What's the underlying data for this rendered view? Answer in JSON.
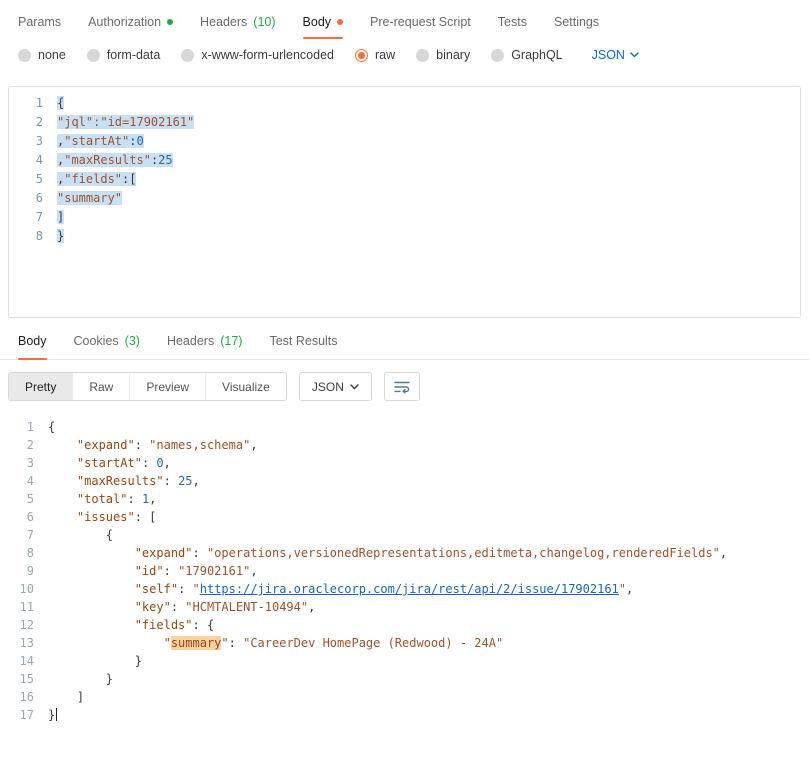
{
  "colors": {
    "accent_orange": "#ff6c37",
    "badge_green": "#28a745",
    "link_blue": "#1a66bc",
    "selection_blue": "#c7e0f5",
    "search_highlight_orange": "#fbd3a0"
  },
  "request": {
    "tabs": [
      {
        "label": "Params"
      },
      {
        "label": "Authorization",
        "dot": "green"
      },
      {
        "label": "Headers",
        "count": "(10)"
      },
      {
        "label": "Body",
        "dot": "orange",
        "active": true
      },
      {
        "label": "Pre-request Script"
      },
      {
        "label": "Tests"
      },
      {
        "label": "Settings"
      }
    ],
    "body_types": [
      "none",
      "form-data",
      "x-www-form-urlencoded",
      "raw",
      "binary",
      "GraphQL"
    ],
    "selected_body_type": "raw",
    "language": "JSON",
    "lines": [
      [
        {
          "t": "{",
          "c": "pun",
          "sel": true
        }
      ],
      [
        {
          "t": "\"jql\":\"id=17902161\"",
          "c": "str",
          "sel": true
        }
      ],
      [
        {
          "t": ",",
          "c": "pun",
          "sel": true
        },
        {
          "t": "\"startAt\"",
          "c": "str",
          "sel": true
        },
        {
          "t": ":",
          "c": "pun",
          "sel": true
        },
        {
          "t": "0",
          "c": "num",
          "sel": true
        }
      ],
      [
        {
          "t": ",",
          "c": "pun",
          "sel": true
        },
        {
          "t": "\"maxResults\"",
          "c": "str",
          "sel": true
        },
        {
          "t": ":",
          "c": "pun",
          "sel": true
        },
        {
          "t": "25",
          "c": "num",
          "sel": true
        }
      ],
      [
        {
          "t": ",",
          "c": "pun",
          "sel": true
        },
        {
          "t": "\"fields\"",
          "c": "str",
          "sel": true
        },
        {
          "t": ":[",
          "c": "pun",
          "sel": true
        }
      ],
      [
        {
          "t": "\"summary\"",
          "c": "str",
          "sel": true
        }
      ],
      [
        {
          "t": "]",
          "c": "pun",
          "sel": true
        }
      ],
      [
        {
          "t": "}",
          "c": "pun",
          "sel": true
        }
      ]
    ]
  },
  "response": {
    "tabs": [
      {
        "label": "Body",
        "active": true
      },
      {
        "label": "Cookies",
        "count": "(3)"
      },
      {
        "label": "Headers",
        "count": "(17)"
      },
      {
        "label": "Test Results"
      }
    ],
    "views": [
      "Pretty",
      "Raw",
      "Preview",
      "Visualize"
    ],
    "active_view": "Pretty",
    "language": "JSON",
    "lines": [
      [
        {
          "t": "{",
          "c": "pun"
        }
      ],
      [
        {
          "t": "    ",
          "c": "ws"
        },
        {
          "t": "\"expand\"",
          "c": "key"
        },
        {
          "t": ": ",
          "c": "pun"
        },
        {
          "t": "\"names,schema\"",
          "c": "str"
        },
        {
          "t": ",",
          "c": "pun"
        }
      ],
      [
        {
          "t": "    ",
          "c": "ws"
        },
        {
          "t": "\"startAt\"",
          "c": "key"
        },
        {
          "t": ": ",
          "c": "pun"
        },
        {
          "t": "0",
          "c": "num"
        },
        {
          "t": ",",
          "c": "pun"
        }
      ],
      [
        {
          "t": "    ",
          "c": "ws"
        },
        {
          "t": "\"maxResults\"",
          "c": "key"
        },
        {
          "t": ": ",
          "c": "pun"
        },
        {
          "t": "25",
          "c": "num"
        },
        {
          "t": ",",
          "c": "pun"
        }
      ],
      [
        {
          "t": "    ",
          "c": "ws"
        },
        {
          "t": "\"total\"",
          "c": "key"
        },
        {
          "t": ": ",
          "c": "pun"
        },
        {
          "t": "1",
          "c": "num"
        },
        {
          "t": ",",
          "c": "pun"
        }
      ],
      [
        {
          "t": "    ",
          "c": "ws"
        },
        {
          "t": "\"issues\"",
          "c": "key"
        },
        {
          "t": ": ",
          "c": "pun"
        },
        {
          "t": "[",
          "c": "pun"
        }
      ],
      [
        {
          "t": "        {",
          "c": "pun"
        }
      ],
      [
        {
          "t": "            ",
          "c": "ws"
        },
        {
          "t": "\"expand\"",
          "c": "key"
        },
        {
          "t": ": ",
          "c": "pun"
        },
        {
          "t": "\"operations,versionedRepresentations,editmeta,changelog,renderedFields\"",
          "c": "str"
        },
        {
          "t": ",",
          "c": "pun"
        }
      ],
      [
        {
          "t": "            ",
          "c": "ws"
        },
        {
          "t": "\"id\"",
          "c": "key"
        },
        {
          "t": ": ",
          "c": "pun"
        },
        {
          "t": "\"17902161\"",
          "c": "str"
        },
        {
          "t": ",",
          "c": "pun"
        }
      ],
      [
        {
          "t": "            ",
          "c": "ws"
        },
        {
          "t": "\"self\"",
          "c": "key"
        },
        {
          "t": ": ",
          "c": "pun"
        },
        {
          "t": "\"",
          "c": "str"
        },
        {
          "t": "https://jira.oraclecorp.com/jira/rest/api/2/issue/17902161",
          "c": "link"
        },
        {
          "t": "\"",
          "c": "str"
        },
        {
          "t": ",",
          "c": "pun"
        }
      ],
      [
        {
          "t": "            ",
          "c": "ws"
        },
        {
          "t": "\"key\"",
          "c": "key"
        },
        {
          "t": ": ",
          "c": "pun"
        },
        {
          "t": "\"HCMTALENT-10494\"",
          "c": "str"
        },
        {
          "t": ",",
          "c": "pun"
        }
      ],
      [
        {
          "t": "            ",
          "c": "ws"
        },
        {
          "t": "\"fields\"",
          "c": "key"
        },
        {
          "t": ": ",
          "c": "pun"
        },
        {
          "t": "{",
          "c": "pun"
        }
      ],
      [
        {
          "t": "                ",
          "c": "ws"
        },
        {
          "t": "\"",
          "c": "key"
        },
        {
          "t": "summary",
          "c": "key hl"
        },
        {
          "t": "\"",
          "c": "key"
        },
        {
          "t": ": ",
          "c": "pun"
        },
        {
          "t": "\"CareerDev HomePage (Redwood) - 24A\"",
          "c": "str"
        }
      ],
      [
        {
          "t": "            }",
          "c": "pun"
        }
      ],
      [
        {
          "t": "        }",
          "c": "pun"
        }
      ],
      [
        {
          "t": "    ]",
          "c": "pun"
        }
      ],
      [
        {
          "t": "}",
          "c": "pun"
        },
        {
          "t": "",
          "c": "cursor"
        }
      ]
    ]
  }
}
